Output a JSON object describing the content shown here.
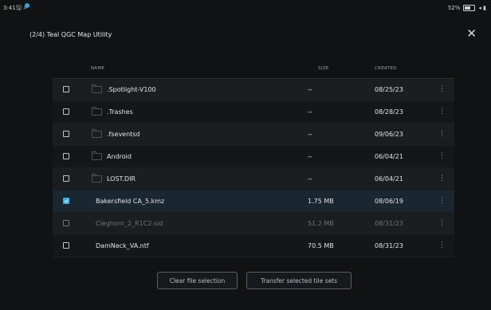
{
  "status_bar": {
    "time": "3:41",
    "notification_icons": "🖫 ⌕",
    "battery_percent": "52%",
    "signal": "◂ ▮"
  },
  "dialog": {
    "title": "(2/4) Teal QGC Map Utility",
    "close_glyph": "✕"
  },
  "table": {
    "headers": {
      "name": "NAME",
      "size": "SIZE",
      "created": "CREATED"
    },
    "rows": [
      {
        "name": ".Spotlight-V100",
        "size": "--",
        "created": "08/25/23",
        "folder": true,
        "checked": false,
        "disabled": false
      },
      {
        "name": ".Trashes",
        "size": "--",
        "created": "08/28/23",
        "folder": true,
        "checked": false,
        "disabled": false
      },
      {
        "name": ".fseventsd",
        "size": "--",
        "created": "09/06/23",
        "folder": true,
        "checked": false,
        "disabled": false
      },
      {
        "name": "Android",
        "size": "--",
        "created": "06/04/21",
        "folder": true,
        "checked": false,
        "disabled": false
      },
      {
        "name": "LOST.DIR",
        "size": "--",
        "created": "06/04/21",
        "folder": true,
        "checked": false,
        "disabled": false
      },
      {
        "name": "Bakersfield CA_5.kmz",
        "size": "1.75 MB",
        "created": "08/06/19",
        "folder": false,
        "checked": true,
        "disabled": false
      },
      {
        "name": "Cleghorn_2_R1C2.sid",
        "size": "51.2 MB",
        "created": "08/31/23",
        "folder": false,
        "checked": false,
        "disabled": true
      },
      {
        "name": "DamNeck_VA.ntf",
        "size": "70.5 MB",
        "created": "08/31/23",
        "folder": false,
        "checked": false,
        "disabled": false
      }
    ],
    "row_menu_glyph": "⋮"
  },
  "actions": {
    "clear_label": "Clear file selection",
    "transfer_label": "Transfer selected tile sets"
  },
  "colors": {
    "background": "#101214",
    "accent": "#3aaee8"
  }
}
